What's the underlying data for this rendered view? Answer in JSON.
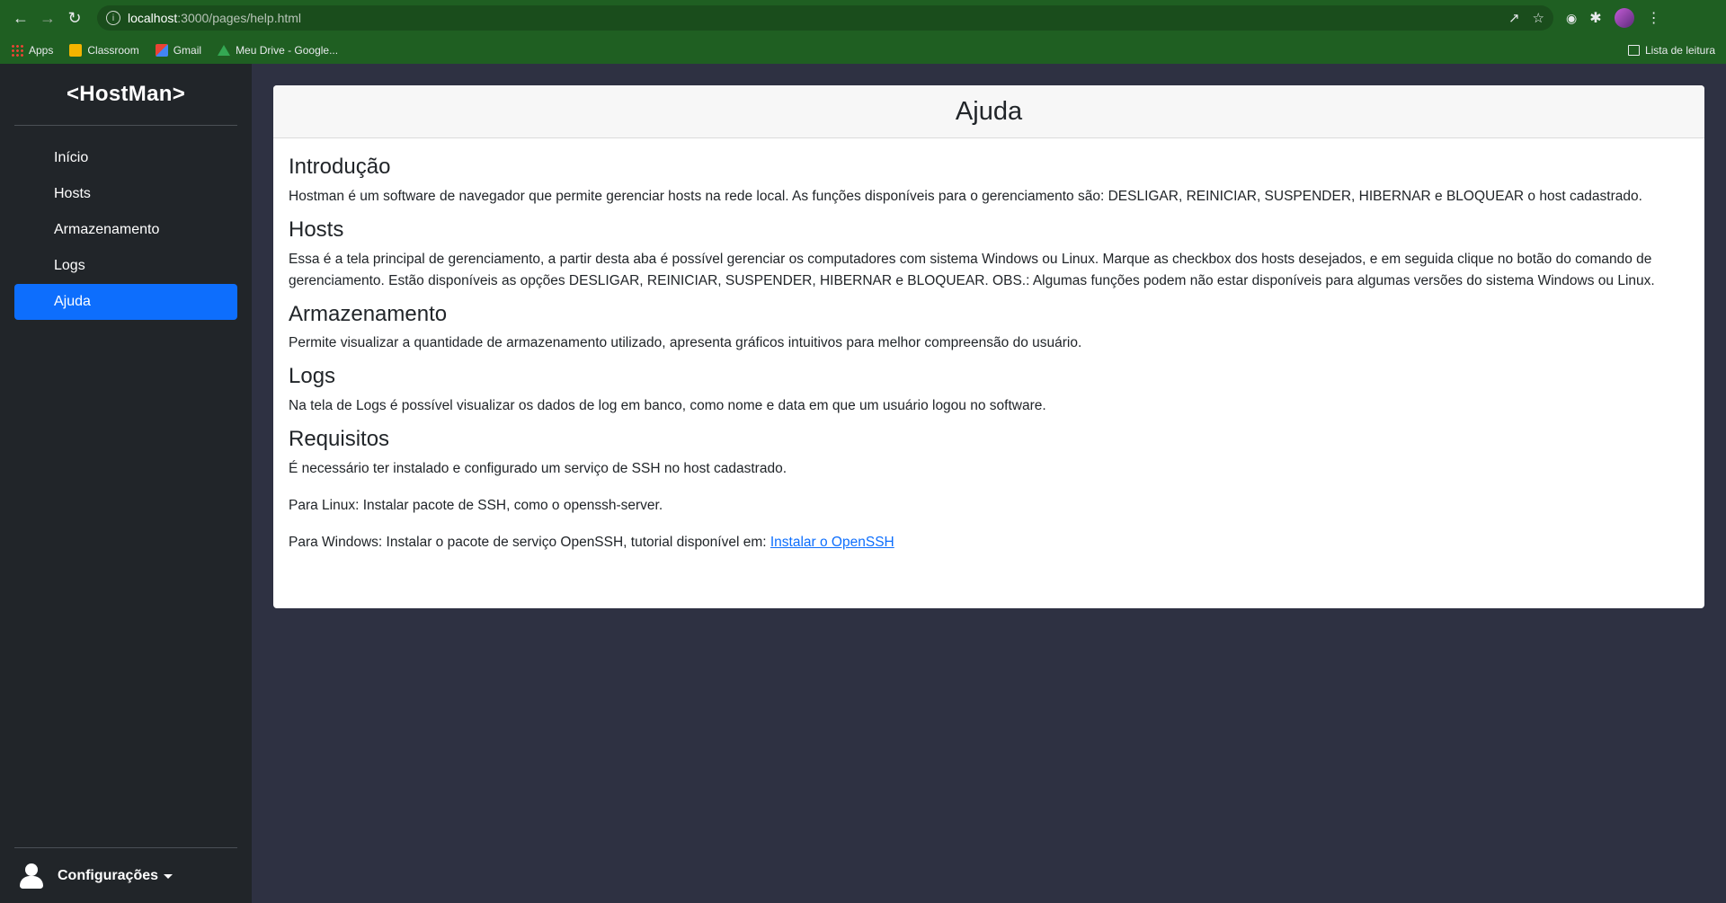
{
  "browser": {
    "url_host": "localhost",
    "url_path": ":3000/pages/help.html",
    "bookmarks": [
      "Apps",
      "Classroom",
      "Gmail",
      "Meu Drive - Google..."
    ],
    "reading_list": "Lista de leitura"
  },
  "sidebar": {
    "brand": "<HostMan>",
    "items": [
      {
        "label": "Início",
        "active": false
      },
      {
        "label": "Hosts",
        "active": false
      },
      {
        "label": "Armazenamento",
        "active": false
      },
      {
        "label": "Logs",
        "active": false
      },
      {
        "label": "Ajuda",
        "active": true
      }
    ],
    "settings_label": "Configurações"
  },
  "page": {
    "title": "Ajuda",
    "sections": [
      {
        "heading": "Introdução",
        "text": "Hostman é um software de navegador que permite gerenciar hosts na rede local. As funções disponíveis para o gerenciamento são: DESLIGAR, REINICIAR, SUSPENDER, HIBERNAR e BLOQUEAR o host cadastrado."
      },
      {
        "heading": "Hosts",
        "text": "Essa é a tela principal de gerenciamento, a partir desta aba é possível gerenciar os computadores com sistema Windows ou Linux. Marque as checkbox dos hosts desejados, e em seguida clique no botão do comando de gerenciamento. Estão disponíveis as opções DESLIGAR, REINICIAR, SUSPENDER, HIBERNAR e BLOQUEAR. OBS.: Algumas funções podem não estar disponíveis para algumas versões do sistema Windows ou Linux."
      },
      {
        "heading": "Armazenamento",
        "text": "Permite visualizar a quantidade de armazenamento utilizado, apresenta gráficos intuitivos para melhor compreensão do usuário."
      },
      {
        "heading": "Logs",
        "text": "Na tela de Logs é possível visualizar os dados de log em banco, como nome e data em que um usuário logou no software."
      },
      {
        "heading": "Requisitos",
        "text": "É necessário ter instalado e configurado um serviço de SSH no host cadastrado.",
        "linux": "Para Linux: Instalar pacote de SSH, como o openssh-server.",
        "windows": "Para Windows: Instalar o pacote de serviço OpenSSH, tutorial disponível em: ",
        "link_label": "Instalar o OpenSSH"
      }
    ]
  },
  "colors": {
    "browser_chrome": "#1f5f22",
    "sidebar_bg": "#212529",
    "main_bg": "#2e3142",
    "active_item": "#0d6efd",
    "link": "#0d6efd"
  }
}
